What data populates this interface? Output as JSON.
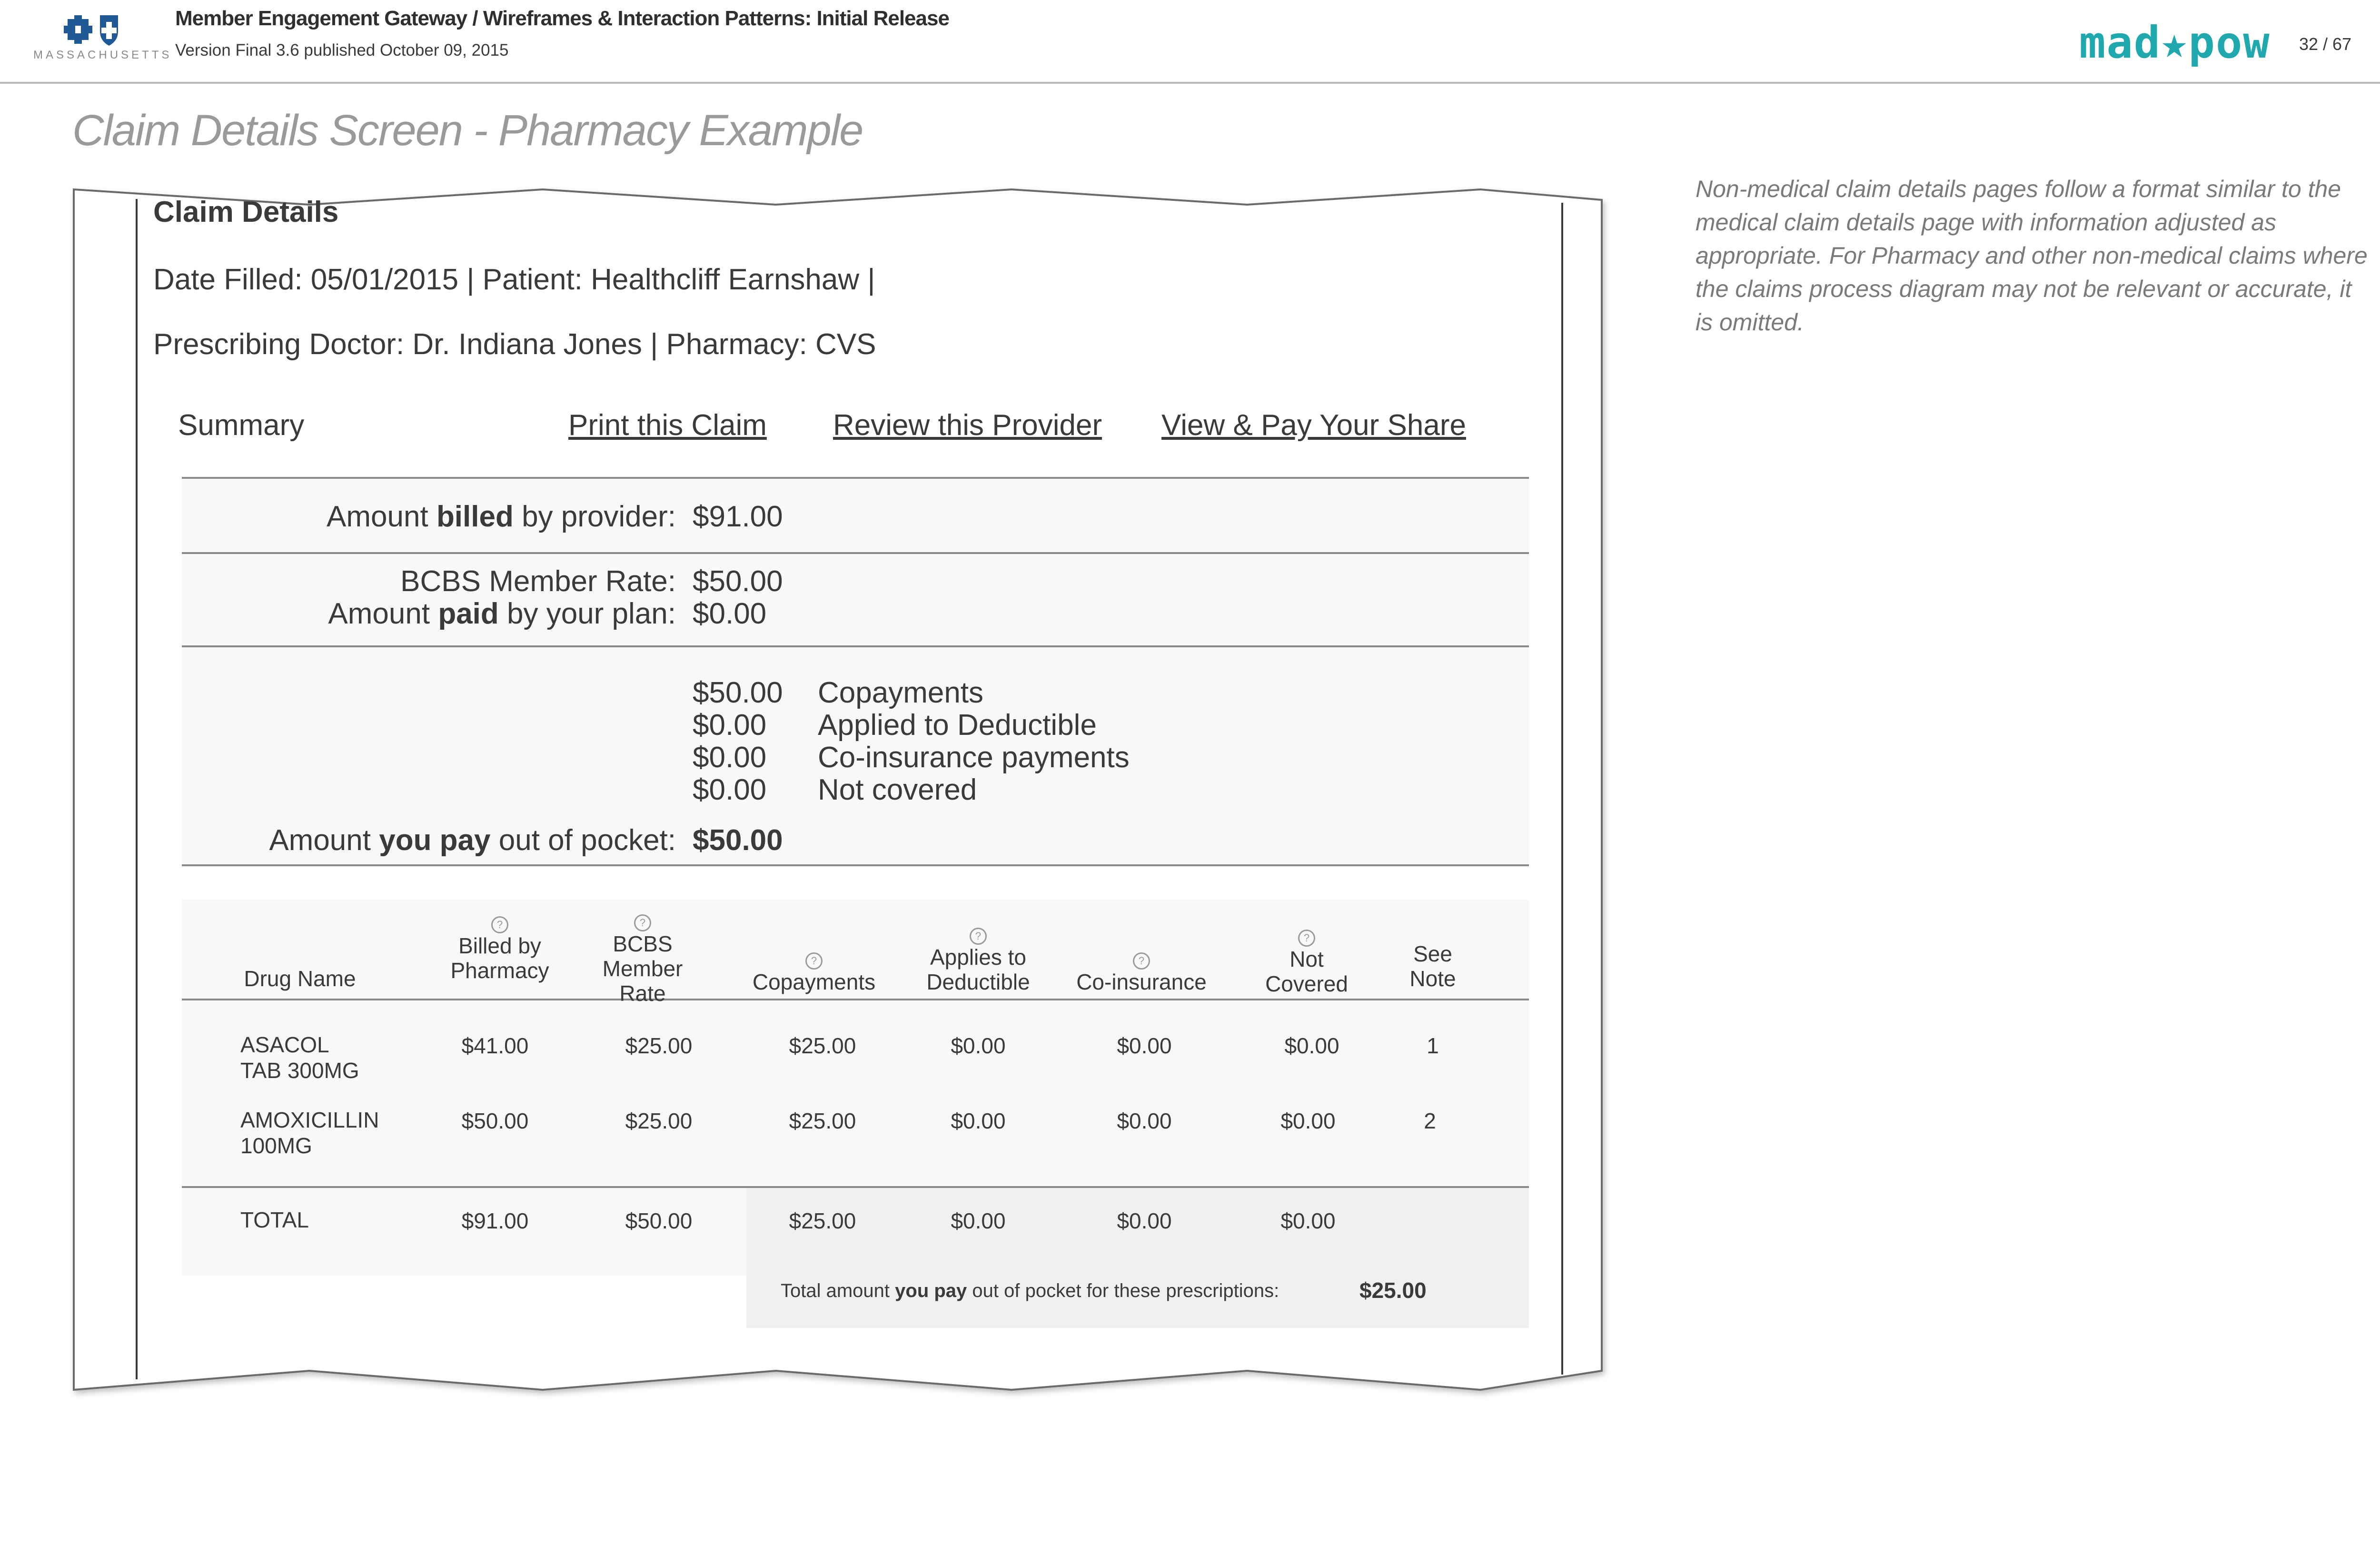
{
  "header": {
    "brand_text": "MASSACHUSETTS",
    "title": "Member Engagement Gateway / Wireframes & Interaction Patterns: Initial Release",
    "version": "Version Final 3.6 published October 09, 2015",
    "agency_logo": "mad★pow",
    "page_number": "32 / 67"
  },
  "page_title": "Claim Details Screen - Pharmacy Example",
  "side_note": "Non-medical claim details pages follow a format similar to the medical claim details page with information adjusted as appropriate. For Pharmacy and other non-medical claims where the claims process diagram may not be relevant or accurate, it is omitted.",
  "claim": {
    "heading": "Claim Details",
    "line1": "Date Filled: 05/01/2015  |  Patient: Healthcliff Earnshaw |",
    "line2": "Prescribing Doctor: Dr. Indiana Jones  |  Pharmacy: CVS"
  },
  "tabs": {
    "summary": "Summary",
    "print": "Print this Claim",
    "review": "Review this Provider",
    "pay": "View & Pay Your Share"
  },
  "summary": {
    "billed_pre": "Amount ",
    "billed_bold": "billed",
    "billed_post": " by provider:",
    "billed_value": "$91.00",
    "member_rate_label": "BCBS Member Rate:",
    "member_rate_value": "$50.00",
    "paid_pre": "Amount ",
    "paid_bold": "paid",
    "paid_post": " by your plan:",
    "paid_value": "$0.00",
    "breakdown": [
      {
        "value": "$50.00",
        "label": "Copayments"
      },
      {
        "value": "$0.00",
        "label": "Applied to Deductible"
      },
      {
        "value": "$0.00",
        "label": "Co-insurance payments"
      },
      {
        "value": "$0.00",
        "label": "Not covered"
      }
    ],
    "oop_pre": "Amount ",
    "oop_bold": "you pay",
    "oop_post": " out of pocket:",
    "oop_value": "$50.00"
  },
  "table": {
    "columns": [
      {
        "line1": "Drug Name",
        "line2": "",
        "line3": "",
        "help": false
      },
      {
        "line1": "Billed by",
        "line2": "Pharmacy",
        "line3": "",
        "help": true
      },
      {
        "line1": "BCBS",
        "line2": "Member",
        "line3": "Rate",
        "help": true
      },
      {
        "line1": "Copayments",
        "line2": "",
        "line3": "",
        "help": true
      },
      {
        "line1": "Applies to",
        "line2": "Deductible",
        "line3": "",
        "help": true
      },
      {
        "line1": "Co-insurance",
        "line2": "",
        "line3": "",
        "help": true
      },
      {
        "line1": "Not",
        "line2": "Covered",
        "line3": "",
        "help": true
      },
      {
        "line1": "See",
        "line2": "Note",
        "line3": "",
        "help": false
      }
    ],
    "help_glyph": "?",
    "rows": [
      {
        "name1": "ASACOL",
        "name2": "TAB 300MG",
        "billed": "$41.00",
        "rate": "$25.00",
        "copay": "$25.00",
        "deductible": "$0.00",
        "coins": "$0.00",
        "notcovered": "$0.00",
        "note": "1"
      },
      {
        "name1": "AMOXICILLIN",
        "name2": "100MG",
        "billed": "$50.00",
        "rate": "$25.00",
        "copay": "$25.00",
        "deductible": "$0.00",
        "coins": "$0.00",
        "notcovered": "$0.00",
        "note": "2"
      }
    ],
    "total": {
      "name": "TOTAL",
      "billed": "$91.00",
      "rate": "$50.00",
      "copay": "$25.00",
      "deductible": "$0.00",
      "coins": "$0.00",
      "notcovered": "$0.00"
    },
    "oop_pre": "Total amount ",
    "oop_bold": "you pay",
    "oop_post": " out of pocket for these prescriptions:",
    "oop_value": "$25.00"
  },
  "colors": {
    "accent_teal": "#1fa8ad",
    "bcbs_blue": "#1f5a96",
    "title_grey": "#9a9a9a"
  }
}
